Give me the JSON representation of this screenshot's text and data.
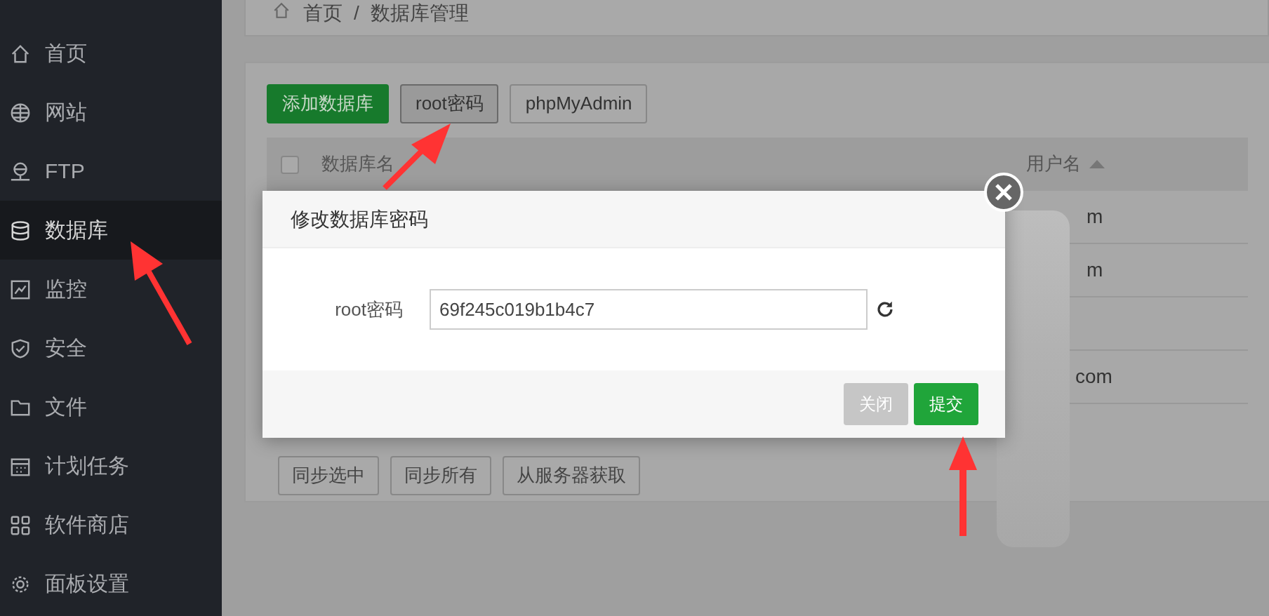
{
  "sidebar": {
    "items": [
      {
        "label": "首页",
        "kind": "home",
        "selected": false
      },
      {
        "label": "网站",
        "kind": "globe",
        "selected": false
      },
      {
        "label": "FTP",
        "kind": "ftp",
        "selected": false
      },
      {
        "label": "数据库",
        "kind": "database",
        "selected": true
      },
      {
        "label": "监控",
        "kind": "monitor",
        "selected": false
      },
      {
        "label": "安全",
        "kind": "shield",
        "selected": false
      },
      {
        "label": "文件",
        "kind": "folder",
        "selected": false
      },
      {
        "label": "计划任务",
        "kind": "calendar",
        "selected": false
      },
      {
        "label": "软件商店",
        "kind": "grid",
        "selected": false
      },
      {
        "label": "面板设置",
        "kind": "gear",
        "selected": false
      }
    ]
  },
  "breadcrumb": [
    "首页",
    "/",
    "数据库管理"
  ],
  "toolbar": [
    {
      "label": "添加数据库",
      "kind": "primary",
      "selected": false
    },
    {
      "label": "root密码",
      "kind": "default",
      "selected": true
    },
    {
      "label": "phpMyAdmin",
      "kind": "default",
      "selected": false
    }
  ],
  "table": {
    "columns": [
      {
        "label": "数据库名",
        "sorted": false
      },
      {
        "label": "用户名",
        "sorted": true
      }
    ],
    "all_checked": false,
    "rows": [
      {
        "username": "m"
      },
      {
        "username": "m"
      },
      {
        "username": "com"
      }
    ]
  },
  "bottom_buttons": [
    "同步选中",
    "同步所有",
    "从服务器获取"
  ],
  "dialog": {
    "title": "修改数据库密码",
    "field_label": "root密码",
    "value": "69f245c019b1b4c7",
    "buttons": [
      {
        "label": "关闭",
        "kind": "secondary"
      },
      {
        "label": "提交",
        "kind": "primary"
      }
    ]
  }
}
